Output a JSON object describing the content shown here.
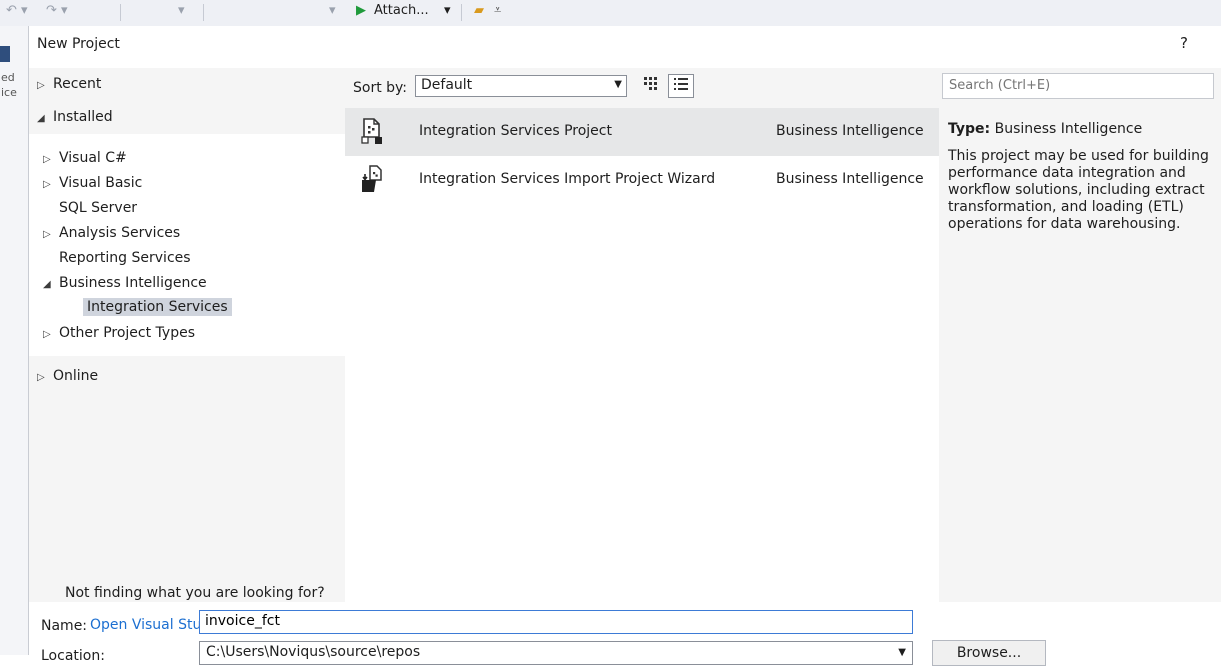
{
  "ide": {
    "toolbar": {
      "attach_label": "Attach...",
      "attach_dropdown": "▾"
    }
  },
  "dialog": {
    "title": "New Project",
    "help": "?"
  },
  "left_pane": {
    "recent": "Recent",
    "installed": "Installed",
    "tree": [
      {
        "label": "Visual C#",
        "arrow": "▷"
      },
      {
        "label": "Visual Basic",
        "arrow": "▷"
      },
      {
        "label": "SQL Server",
        "arrow": ""
      },
      {
        "label": "Analysis Services",
        "arrow": "▷"
      },
      {
        "label": "Reporting Services",
        "arrow": ""
      },
      {
        "label": "Business Intelligence",
        "arrow": "◢"
      },
      {
        "label": "Integration Services",
        "arrow": ""
      },
      {
        "label": "Other Project Types",
        "arrow": "▷"
      }
    ],
    "online": "Online",
    "not_finding": "Not finding what you are looking for?",
    "installer_link": "Open Visual Studio Installer"
  },
  "middle_pane": {
    "sort_label": "Sort by:",
    "sort_value": "Default",
    "templates": [
      {
        "name": "Integration Services Project",
        "category": "Business Intelligence",
        "icon": "ssis-project-icon"
      },
      {
        "name": "Integration Services Import Project Wizard",
        "category": "Business Intelligence",
        "icon": "ssis-import-wizard-icon"
      }
    ]
  },
  "right_pane": {
    "search_placeholder": "Search (Ctrl+E)",
    "type_label": "Type:",
    "type_value": "Business Intelligence",
    "description": "This project may be used for building\nperformance data integration and\nworkflow solutions, including extract\ntransformation, and loading (ETL)\noperations for data warehousing."
  },
  "bottom": {
    "name_label": "Name:",
    "name_value": "invoice_fct",
    "location_label": "Location:",
    "location_value": "C:\\Users\\Noviqus\\source\\repos",
    "browse_label": "Browse..."
  },
  "colors": {
    "link": "#1c6fd1",
    "selection": "#cfd4dd",
    "focus_border": "#3d7bd6",
    "play_green": "#1f9a3b"
  }
}
